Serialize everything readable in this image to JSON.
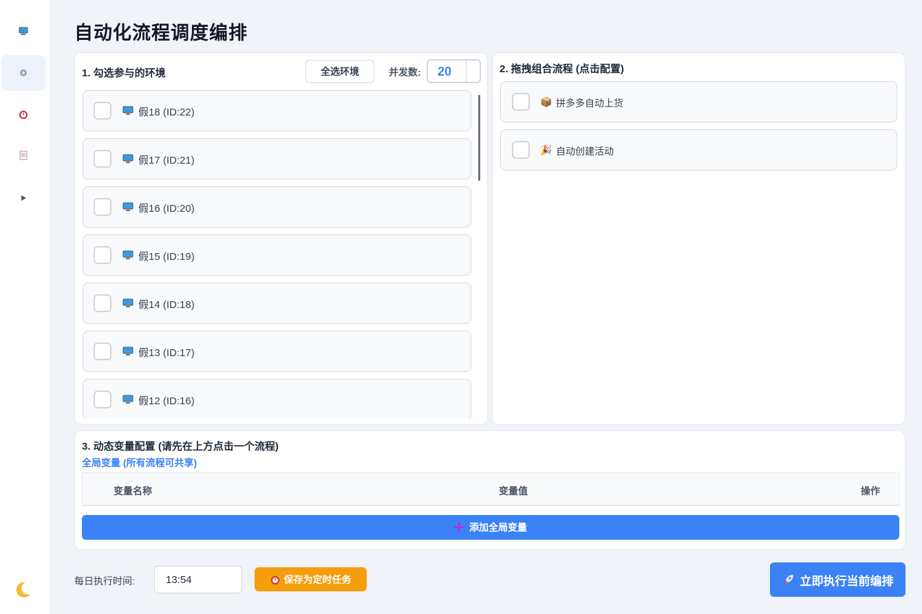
{
  "page": {
    "title": "自动化流程调度编排"
  },
  "sidebar": {
    "items": [
      {
        "icon": "computer-icon",
        "active": false
      },
      {
        "icon": "gear-icon",
        "active": true
      },
      {
        "icon": "alarm-clock-icon",
        "active": false
      },
      {
        "icon": "memo-icon",
        "active": false
      },
      {
        "icon": "play-icon",
        "active": false
      }
    ],
    "theme_icon": "moon-icon"
  },
  "env_panel": {
    "title": "1. 勾选参与的环境",
    "select_all_label": "全选环境",
    "concurrency_label": "并发数:",
    "concurrency_value": "20",
    "envs": [
      {
        "label": "假18 (ID:22)",
        "checked": false
      },
      {
        "label": "假17 (ID:21)",
        "checked": false
      },
      {
        "label": "假16 (ID:20)",
        "checked": false
      },
      {
        "label": "假15 (ID:19)",
        "checked": false
      },
      {
        "label": "假14 (ID:18)",
        "checked": false
      },
      {
        "label": "假13 (ID:17)",
        "checked": false
      },
      {
        "label": "假12 (ID:16)",
        "checked": false
      }
    ]
  },
  "flow_panel": {
    "title": "2. 拖拽组合流程 (点击配置)",
    "flows": [
      {
        "icon": "📦",
        "label": "拼多多自动上货",
        "checked": false
      },
      {
        "icon": "🎉",
        "label": "自动创建活动",
        "checked": false
      }
    ]
  },
  "vars_panel": {
    "title": "3. 动态变量配置 (请先在上方点击一个流程)",
    "subtitle": "全局变量 (所有流程可共享)",
    "columns": [
      "变量名称",
      "变量值",
      "操作"
    ],
    "add_label": "添加全局变量"
  },
  "footer": {
    "time_label": "每日执行时间:",
    "time_value": "13:54",
    "save_label": "保存为定时任务",
    "run_label": "立即执行当前编排"
  },
  "colors": {
    "primary": "#3b82f6",
    "orange": "#f59e0b",
    "accent_text": "#3b82f6"
  }
}
